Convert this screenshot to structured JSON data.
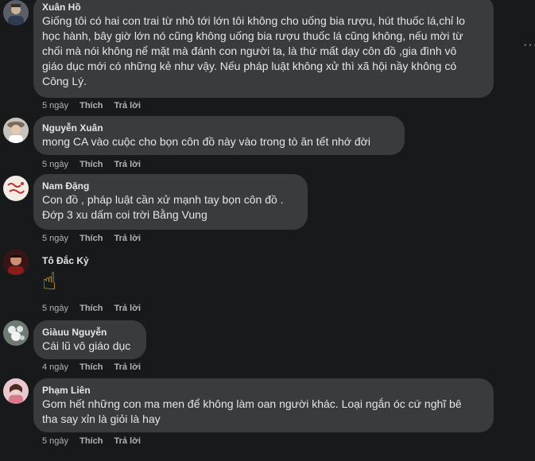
{
  "comments": [
    {
      "author": "Xuân Hồ",
      "lines": [
        "Giống tôi có hai con trai từ nhỏ tới lớn tôi không cho uống bia rượu, hút thuốc lá,chỉ lo",
        "học hành, bây giờ lớn nó cũng không uống bia rượu thuốc lá cũng không, nếu mời từ",
        "chối mà nói không nể mặt mà đánh con người ta, là thứ mất dạy côn đồ ,gia đình vô",
        "giáo dục mới có những kẻ như vậy. Nếu pháp luật không xử thì xã hội nầy không có",
        "Công Lý."
      ],
      "time": "5 ngày",
      "like": "Thích",
      "reply": "Trả lời"
    },
    {
      "author": "Nguyễn Xuân",
      "lines": [
        "mong CA vào cuộc cho bọn côn đồ này vào trong tò ăn tết nhớ đời"
      ],
      "time": "5 ngày",
      "like": "Thích",
      "reply": "Trả lời"
    },
    {
      "author": "Nam Đặng",
      "lines": [
        "Con đồ , pháp luật cần xử mạnh tay bọn côn đồ .",
        "Đớp 3 xu dấm coi trời Bằng Vung"
      ],
      "time": "5 ngày",
      "like": "Thích",
      "reply": "Trả lời"
    },
    {
      "author": "Tô Đắc Kỷ",
      "emoji": "☝",
      "time": "5 ngày",
      "like": "Thích",
      "reply": "Trả lời"
    },
    {
      "author": "Giàuu Nguyễn",
      "lines": [
        "Cái lũ vô giáo dục"
      ],
      "time": "4 ngày",
      "like": "Thích",
      "reply": "Trả lời"
    },
    {
      "author": "Phạm Liên",
      "lines": [
        "Gom hết những con ma men để không làm oan người khác. Loại ngắn óc cứ nghĩ bê",
        "tha say xỉn là giỏi là hay"
      ],
      "time": "5 ngày",
      "like": "Thích",
      "reply": "Trả lời"
    }
  ],
  "menu": {
    "more_label": "···"
  },
  "colors": {
    "background": "#18191a",
    "bubble": "#3a3b3c",
    "text": "#e4e6eb",
    "secondary_text": "#b0b3b8",
    "emoji": "#f5b82e"
  }
}
